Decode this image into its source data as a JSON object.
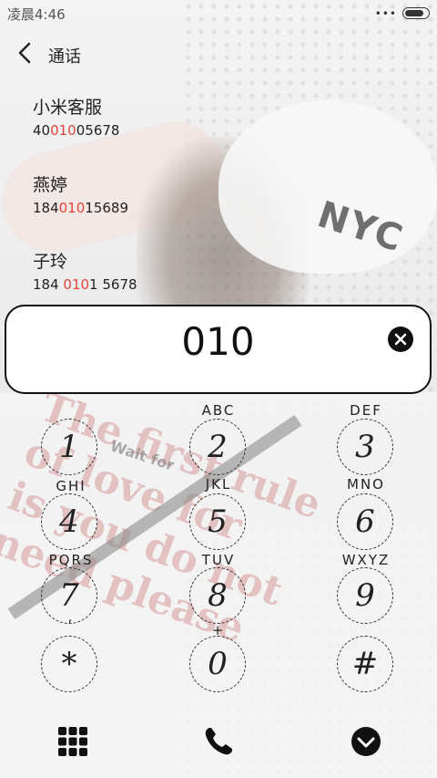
{
  "status_bar": {
    "time": "凌晨4:46",
    "dots": "•••"
  },
  "title_bar": {
    "title": "通话"
  },
  "results": [
    {
      "name": "小米客服",
      "number_pre": "40",
      "number_hl": "010",
      "number_post": "05678"
    },
    {
      "name": "燕婷",
      "number_pre": "184",
      "number_hl": "010",
      "number_post": "15689"
    },
    {
      "name": "子玲",
      "number_pre": "184 ",
      "number_hl": "010",
      "number_post": "1 5678"
    }
  ],
  "display": {
    "value": "010"
  },
  "keypad": [
    {
      "digit": "1",
      "letters": ""
    },
    {
      "digit": "2",
      "letters": "ABC"
    },
    {
      "digit": "3",
      "letters": "DEF"
    },
    {
      "digit": "4",
      "letters": "GHI"
    },
    {
      "digit": "5",
      "letters": "JKL"
    },
    {
      "digit": "6",
      "letters": "MNO"
    },
    {
      "digit": "7",
      "letters": "PQRS"
    },
    {
      "digit": "8",
      "letters": "TUV"
    },
    {
      "digit": "9",
      "letters": "WXYZ"
    },
    {
      "digit": "*",
      "letters": ","
    },
    {
      "digit": "0",
      "letters": "+"
    },
    {
      "digit": "#",
      "letters": ""
    }
  ],
  "bottom_bar": {
    "icons": [
      "grid-icon",
      "phone-icon",
      "chevron-down-icon"
    ]
  },
  "colors": {
    "highlight": "#e0443a",
    "ink": "#111111"
  }
}
